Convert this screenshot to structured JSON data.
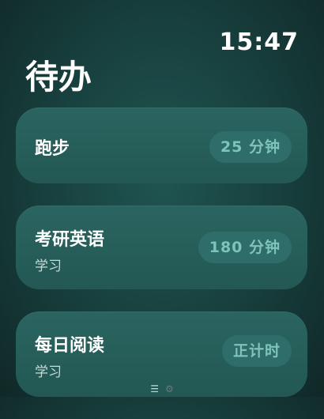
{
  "status": {
    "time": "15:47"
  },
  "header": {
    "title": "待办"
  },
  "tasks": [
    {
      "name": "跑步",
      "subtitle": "",
      "duration": "25 分钟"
    },
    {
      "name": "考研英语",
      "subtitle": "学习",
      "duration": "180 分钟"
    },
    {
      "name": "每日阅读",
      "subtitle": "学习",
      "duration": "正计时"
    }
  ],
  "page_indicator": {
    "items": [
      "list-icon",
      "gear-icon"
    ],
    "active": "list-icon"
  },
  "colors": {
    "background": "#173e3c",
    "card": "#2a6460",
    "pill": "#2e6d69",
    "pill_text": "#7fc4ba",
    "subtext": "#c9d9d7"
  }
}
